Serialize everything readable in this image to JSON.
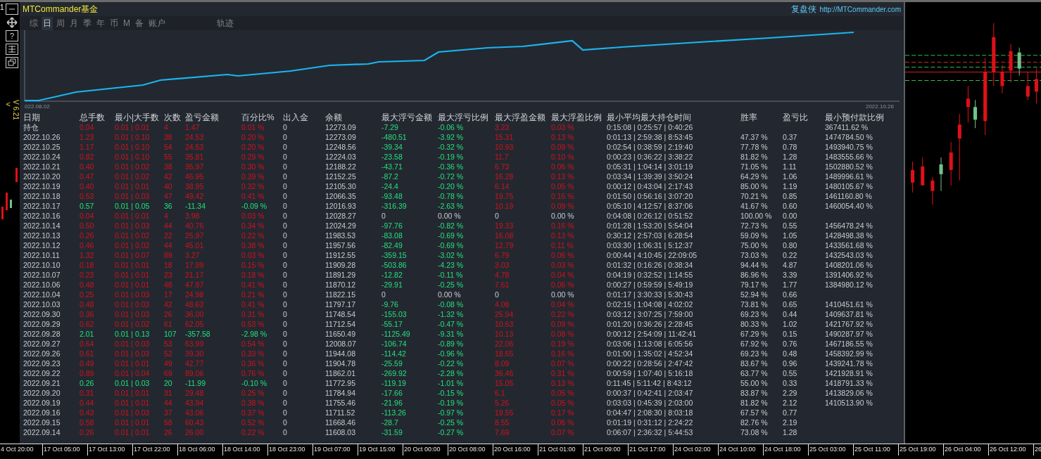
{
  "side_toolbar": {
    "corner": "1",
    "help": "?",
    "back": "<",
    "version": "V 6.21"
  },
  "panel": {
    "title": "MTCommander基金",
    "brand": "复盘侠",
    "link": "http://MTCommander.com",
    "tabs": [
      {
        "label": "综",
        "selected": false
      },
      {
        "label": "日",
        "selected": true
      },
      {
        "label": "周",
        "selected": false
      },
      {
        "label": "月",
        "selected": false
      },
      {
        "label": "季",
        "selected": false
      },
      {
        "label": "年",
        "selected": false
      },
      {
        "label": "币",
        "selected": false
      },
      {
        "label": "M",
        "selected": false
      },
      {
        "label": "备",
        "selected": false
      },
      {
        "label": "账户",
        "selected": false
      },
      {
        "label": "轨迹",
        "selected": false
      }
    ],
    "equity_chart": {
      "start_label": "022.08.02",
      "end_label": "2022.10.26"
    },
    "table": {
      "columns": [
        {
          "label": "日期",
          "kind": "plain"
        },
        {
          "label": "总手数",
          "kind": "result"
        },
        {
          "label": "最小|大手数",
          "kind": "result"
        },
        {
          "label": "次数",
          "kind": "result"
        },
        {
          "label": "盈亏金额",
          "kind": "result"
        },
        {
          "label": "百分比%",
          "kind": "result"
        },
        {
          "label": "出入金",
          "kind": "plain"
        },
        {
          "label": "余额",
          "kind": "plain"
        },
        {
          "label": "最大浮亏金额",
          "kind": "float_loss"
        },
        {
          "label": "最大浮亏比例",
          "kind": "float_loss"
        },
        {
          "label": "最大浮盈金额",
          "kind": "float_profit"
        },
        {
          "label": "最大浮盈比例",
          "kind": "float_profit"
        },
        {
          "label": "最小平均最大持仓时间",
          "kind": "plain"
        },
        {
          "label": "胜率",
          "kind": "plain"
        },
        {
          "label": "盈亏比",
          "kind": "plain"
        },
        {
          "label": "最小预付款比例",
          "kind": "plain"
        }
      ],
      "rows": [
        {
          "kind": "gain",
          "float_zero": false,
          "cells": [
            "持仓",
            "0.04",
            "0.01 | 0.01",
            "4",
            "1.47",
            "0.01 %",
            "0",
            "12273.09",
            "-7.29",
            "-0.06 %",
            "3.23",
            "0.03 %",
            "0:15:08 | 0:25:57 | 0:40:26",
            null,
            null,
            "367411.62 %"
          ]
        },
        {
          "kind": "gain",
          "float_zero": false,
          "cells": [
            "2022.10.26",
            "1.23",
            "0.01 | 0.10",
            "38",
            "24.53",
            "0.20 %",
            "0",
            "12273.09",
            "-480.51",
            "-3.92 %",
            "15.31",
            "0.13 %",
            "0:01:13 | 2:59:38 | 8:53:45",
            "47.37 %",
            "0.37",
            "1474784.50 %"
          ]
        },
        {
          "kind": "gain",
          "float_zero": false,
          "cells": [
            "2022.10.25",
            "1.17",
            "0.01 | 0.10",
            "54",
            "24.53",
            "0.20 %",
            "0",
            "12248.56",
            "-39.34",
            "-0.32 %",
            "10.93",
            "0.09 %",
            "0:02:54 | 0:38:59 | 2:19:40",
            "77.78 %",
            "0.78",
            "1493940.75 %"
          ]
        },
        {
          "kind": "gain",
          "float_zero": false,
          "cells": [
            "2022.10.24",
            "0.82",
            "0.01 | 0.10",
            "55",
            "35.81",
            "0.29 %",
            "0",
            "12224.03",
            "-23.58",
            "-0.19 %",
            "11.7",
            "0.10 %",
            "0:00:23 | 0:36:22 | 3:38:22",
            "81.82 %",
            "1.28",
            "1483555.66 %"
          ]
        },
        {
          "kind": "gain",
          "float_zero": false,
          "cells": [
            "2022.10.21",
            "0.40",
            "0.01 | 0.02",
            "38",
            "35.97",
            "0.30 %",
            "0",
            "12188.22",
            "-43.71",
            "-0.36 %",
            "6.73",
            "0.06 %",
            "0:05:31 | 1:04:14 | 3:01:19",
            "71.05 %",
            "1.11",
            "1502880.52 %"
          ]
        },
        {
          "kind": "gain",
          "float_zero": false,
          "cells": [
            "2022.10.20",
            "0.47",
            "0.01 | 0.02",
            "42",
            "46.95",
            "0.39 %",
            "0",
            "12152.25",
            "-87.2",
            "-0.72 %",
            "16.28",
            "0.13 %",
            "0:03:34 | 1:39:39 | 3:50:24",
            "64.29 %",
            "1.06",
            "1489996.61 %"
          ]
        },
        {
          "kind": "gain",
          "float_zero": false,
          "cells": [
            "2022.10.19",
            "0.40",
            "0.01 | 0.01",
            "40",
            "38.95",
            "0.32 %",
            "0",
            "12105.30",
            "-24.4",
            "-0.20 %",
            "6.14",
            "0.05 %",
            "0:00:12 | 0:43:04 | 2:17:43",
            "85.00 %",
            "1.19",
            "1480105.67 %"
          ]
        },
        {
          "kind": "gain",
          "float_zero": false,
          "cells": [
            "2022.10.18",
            "0.53",
            "0.01 | 0.03",
            "47",
            "49.42",
            "0.41 %",
            "0",
            "12066.35",
            "-93.48",
            "-0.78 %",
            "19.75",
            "0.16 %",
            "0:01:50 | 0:56:16 | 3:07:20",
            "70.21 %",
            "0.85",
            "1461160.80 %"
          ]
        },
        {
          "kind": "loss",
          "float_zero": false,
          "cells": [
            "2022.10.17",
            "0.57",
            "0.01 | 0.05",
            "36",
            "-11.34",
            "-0.09 %",
            "0",
            "12016.93",
            "-316.39",
            "-2.63 %",
            "10.19",
            "0.09 %",
            "0:05:10 | 4:12:57 | 8:37:06",
            "41.67 %",
            "0.60",
            "1460054.40 %"
          ]
        },
        {
          "kind": "gain",
          "float_zero": true,
          "cells": [
            "2022.10.16",
            "0.04",
            "0.01 | 0.01",
            "4",
            "3.98",
            "0.03 %",
            "0",
            "12028.27",
            "0",
            "0.00 %",
            "0",
            "0.00 %",
            "0:04:08 | 0:26:12 | 0:51:52",
            "100.00 %",
            "0.00",
            null
          ]
        },
        {
          "kind": "gain",
          "float_zero": false,
          "cells": [
            "2022.10.14",
            "0.50",
            "0.01 | 0.03",
            "44",
            "40.76",
            "0.34 %",
            "0",
            "12024.29",
            "-97.76",
            "-0.82 %",
            "19.33",
            "0.16 %",
            "0:01:28 | 1:53:20 | 5:54:04",
            "72.73 %",
            "0.55",
            "1456478.24 %"
          ]
        },
        {
          "kind": "gain",
          "float_zero": false,
          "cells": [
            "2022.10.13",
            "0.26",
            "0.01 | 0.02",
            "22",
            "25.97",
            "0.22 %",
            "0",
            "11983.53",
            "-83.08",
            "-0.69 %",
            "16.08",
            "0.13 %",
            "0:30:12 | 2:57:03 | 6:28:54",
            "59.09 %",
            "1.05",
            "1428498.38 %"
          ]
        },
        {
          "kind": "gain",
          "float_zero": false,
          "cells": [
            "2022.10.12",
            "0.46",
            "0.01 | 0.02",
            "44",
            "45.01",
            "0.38 %",
            "0",
            "11957.56",
            "-82.49",
            "-0.69 %",
            "12.79",
            "0.11 %",
            "0:03:30 | 1:06:31 | 5:12:37",
            "75.00 %",
            "0.80",
            "1433561.68 %"
          ]
        },
        {
          "kind": "gain",
          "float_zero": false,
          "cells": [
            "2022.10.11",
            "1.32",
            "0.01 | 0.07",
            "89",
            "3.27",
            "0.03 %",
            "0",
            "11912.55",
            "-359.15",
            "-3.02 %",
            "6.79",
            "0.06 %",
            "0:00:44 | 4:10:45 | 22:09:05",
            "73.03 %",
            "0.22",
            "1432543.03 %"
          ]
        },
        {
          "kind": "gain",
          "float_zero": false,
          "cells": [
            "2022.10.10",
            "0.18",
            "0.01 | 0.01",
            "18",
            "17.99",
            "0.15 %",
            "0",
            "11909.28",
            "-503.86",
            "-4.23 %",
            "3.03",
            "0.03 %",
            "0:01:32 | 0:16:26 | 0:38:34",
            "94.44 %",
            "4.87",
            "1408201.06 %"
          ]
        },
        {
          "kind": "gain",
          "float_zero": false,
          "cells": [
            "2022.10.07",
            "0.23",
            "0.01 | 0.01",
            "23",
            "21.17",
            "0.18 %",
            "0",
            "11891.29",
            "-12.82",
            "-0.11 %",
            "4.78",
            "0.04 %",
            "0:04:19 | 0:32:52 | 1:14:55",
            "86.96 %",
            "3.39",
            "1391406.92 %"
          ]
        },
        {
          "kind": "gain",
          "float_zero": false,
          "cells": [
            "2022.10.06",
            "0.48",
            "0.01 | 0.01",
            "48",
            "47.97",
            "0.41 %",
            "0",
            "11870.12",
            "-29.91",
            "-0.25 %",
            "7.61",
            "0.06 %",
            "0:00:27 | 0:59:59 | 5:49:19",
            "79.17 %",
            "1.77",
            "1384980.12 %"
          ]
        },
        {
          "kind": "gain",
          "float_zero": true,
          "cells": [
            "2022.10.04",
            "0.25",
            "0.01 | 0.03",
            "17",
            "24.98",
            "0.21 %",
            "0",
            "11822.15",
            "0",
            "0.00 %",
            "0",
            "0.00 %",
            "0:01:17 | 3:30:33 | 5:30:43",
            "52.94 %",
            "0.66",
            null
          ]
        },
        {
          "kind": "gain",
          "float_zero": false,
          "cells": [
            "2022.10.03",
            "0.48",
            "0.01 | 0.03",
            "42",
            "48.63",
            "0.41 %",
            "0",
            "11797.17",
            "-9.76",
            "-0.08 %",
            "4.08",
            "0.04 %",
            "0:02:15 | 1:04:08 | 4:02:02",
            "73.81 %",
            "0.65",
            "1410451.61 %"
          ]
        },
        {
          "kind": "gain",
          "float_zero": false,
          "cells": [
            "2022.09.30",
            "0.36",
            "0.01 | 0.03",
            "26",
            "36.00",
            "0.31 %",
            "0",
            "11748.54",
            "-155.03",
            "-1.32 %",
            "25.94",
            "0.22 %",
            "0:03:12 | 3:07:25 | 7:59:00",
            "69.23 %",
            "0.44",
            "1409637.81 %"
          ]
        },
        {
          "kind": "gain",
          "float_zero": false,
          "cells": [
            "2022.09.29",
            "0.62",
            "0.01 | 0.02",
            "61",
            "62.05",
            "0.53 %",
            "0",
            "11712.54",
            "-55.17",
            "-0.47 %",
            "10.63",
            "0.09 %",
            "0:01:20 | 0:36:26 | 2:28:45",
            "80.33 %",
            "1.02",
            "1421767.92 %"
          ]
        },
        {
          "kind": "loss",
          "float_zero": false,
          "cells": [
            "2022.09.28",
            "2.01",
            "0.01 | 0.13",
            "107",
            "-357.58",
            "-2.98 %",
            "0",
            "11650.49",
            "-1125.49",
            "-9.31 %",
            "10.13",
            "0.08 %",
            "0:00:12 | 2:54:09 | 11:42:41",
            "67.29 %",
            "0.15",
            "1490287.97 %"
          ]
        },
        {
          "kind": "gain",
          "float_zero": false,
          "cells": [
            "2022.09.27",
            "0.64",
            "0.01 | 0.03",
            "53",
            "63.99",
            "0.54 %",
            "0",
            "12008.07",
            "-106.74",
            "-0.89 %",
            "22.06",
            "0.19 %",
            "0:03:06 | 1:13:08 | 6:05:56",
            "67.92 %",
            "0.76",
            "1467186.55 %"
          ]
        },
        {
          "kind": "gain",
          "float_zero": false,
          "cells": [
            "2022.09.26",
            "0.61",
            "0.01 | 0.03",
            "52",
            "39.30",
            "0.33 %",
            "0",
            "11944.08",
            "-114.42",
            "-0.96 %",
            "18.65",
            "0.16 %",
            "0:01:00 | 1:35:02 | 4:52:34",
            "69.23 %",
            "0.48",
            "1458392.99 %"
          ]
        },
        {
          "kind": "gain",
          "float_zero": false,
          "cells": [
            "2022.09.23",
            "0.49",
            "0.01 | 0.01",
            "49",
            "42.77",
            "0.36 %",
            "0",
            "11904.78",
            "-25.59",
            "-0.22 %",
            "8.09",
            "0.07 %",
            "0:00:22 | 0:28:56 | 2:47:42",
            "83.67 %",
            "0.96",
            "1439241.78 %"
          ]
        },
        {
          "kind": "gain",
          "float_zero": false,
          "cells": [
            "2022.09.22",
            "0.89",
            "0.01 | 0.04",
            "69",
            "89.06",
            "0.76 %",
            "0",
            "11862.01",
            "-269.92",
            "-2.28 %",
            "36.46",
            "0.31 %",
            "0:00:59 | 1:07:40 | 5:16:18",
            "63.77 %",
            "0.55",
            "1421928.91 %"
          ]
        },
        {
          "kind": "loss",
          "float_zero": false,
          "cells": [
            "2022.09.21",
            "0.26",
            "0.01 | 0.03",
            "20",
            "-11.99",
            "-0.10 %",
            "0",
            "11772.95",
            "-119.19",
            "-1.01 %",
            "15.05",
            "0.13 %",
            "0:11:45 | 5:11:42 | 8:43:12",
            "55.00 %",
            "0.33",
            "1418791.33 %"
          ]
        },
        {
          "kind": "gain",
          "float_zero": false,
          "cells": [
            "2022.09.20",
            "0.31",
            "0.01 | 0.01",
            "31",
            "29.48",
            "0.25 %",
            "0",
            "11784.94",
            "-17.66",
            "-0.15 %",
            "6.1",
            "0.05 %",
            "0:00:37 | 0:42:41 | 2:03:47",
            "83.87 %",
            "2.29",
            "1413829.06 %"
          ]
        },
        {
          "kind": "gain",
          "float_zero": false,
          "cells": [
            "2022.09.19",
            "0.44",
            "0.01 | 0.01",
            "44",
            "43.94",
            "0.38 %",
            "0",
            "11755.46",
            "-21.96",
            "-0.19 %",
            "5.26",
            "0.05 %",
            "0:03:03 | 0:45:39 | 2:03:00",
            "81.82 %",
            "2.12",
            "1410513.90 %"
          ]
        },
        {
          "kind": "gain",
          "float_zero": false,
          "cells": [
            "2022.09.16",
            "0.43",
            "0.01 | 0.03",
            "37",
            "43.06",
            "0.37 %",
            "0",
            "11711.52",
            "-113.26",
            "-0.97 %",
            "19.55",
            "0.17 %",
            "0:04:47 | 2:08:30 | 8:03:18",
            "67.57 %",
            "0.77",
            null
          ]
        },
        {
          "kind": "gain",
          "float_zero": false,
          "cells": [
            "2022.09.15",
            "0.58",
            "0.01 | 0.01",
            "58",
            "60.43",
            "0.52 %",
            "0",
            "11668.46",
            "-28.7",
            "-0.25 %",
            "8.55",
            "0.06 %",
            "0:01:19 | 0:31:12 | 2:24:22",
            "82.76 %",
            "2.19",
            null
          ]
        },
        {
          "kind": "gain",
          "float_zero": false,
          "cells": [
            "2022.09.14",
            "0.26",
            "0.01 | 0.01",
            "26",
            "26.00",
            "0.22 %",
            "0",
            "11608.03",
            "-31.59",
            "-0.27 %",
            "7.69",
            "0.07 %",
            "0:06:07 | 2:36:32 | 5:44:53",
            "73.08 %",
            "1.28",
            null
          ]
        }
      ]
    }
  },
  "time_axis": [
    "4 Oct 20:00",
    "17 Oct 05:00",
    "17 Oct 13:00",
    "17 Oct 22:00",
    "18 Oct 06:00",
    "18 Oct 14:00",
    "18 Oct 23:00",
    "19 Oct 07:00",
    "19 Oct 15:00",
    "20 Oct 00:00",
    "20 Oct 08:00",
    "20 Oct 16:00",
    "21 Oct 01:00",
    "21 Oct 09:00",
    "21 Oct 17:00",
    "24 Oct 02:00",
    "24 Oct 10:00",
    "24 Oct 18:00",
    "25 Oct 03:00",
    "25 Oct 11:00",
    "25 Oct 19:00",
    "26 Oct 04:00",
    "26 Oct 12:00",
    "26"
  ]
}
